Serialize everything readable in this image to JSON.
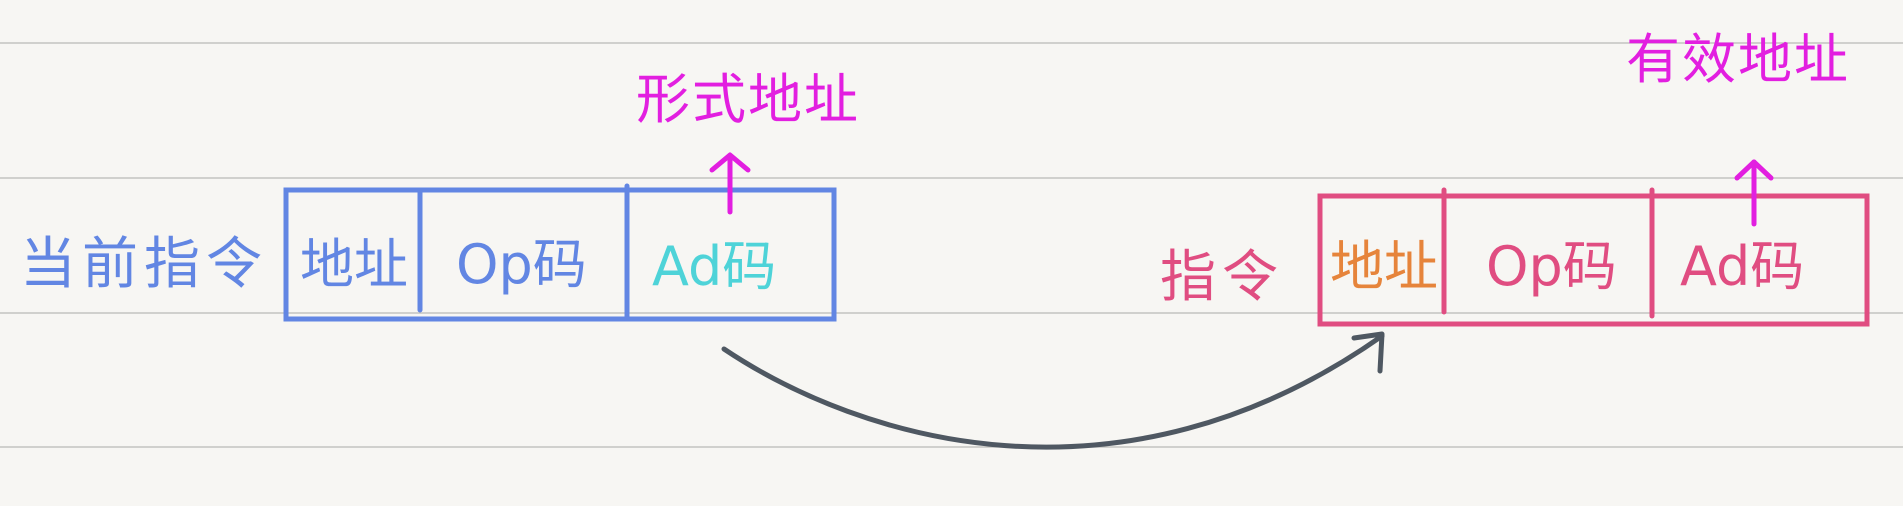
{
  "colors": {
    "background": "#f7f6f3",
    "ruled_line": "#b9b9b6",
    "current_instruction": "#6286e3",
    "address_in_current": "#6286e3",
    "op_code": "#6286e3",
    "ad_code_current": "#4ed3d8",
    "instruction": "#e04d81",
    "address_in_instruction": "#e6843b",
    "formal_address": "#e21fe0",
    "effective_address": "#e21fe0",
    "transition_arrow": "#4f5862"
  },
  "left_group": {
    "label": "当前指令",
    "cells": {
      "address": "地址",
      "opcode": "Op码",
      "adcode": "Ad码"
    },
    "annotation": "形式地址"
  },
  "right_group": {
    "label": "指令",
    "cells": {
      "address": "地址",
      "opcode": "Op码",
      "adcode": "Ad码"
    },
    "annotation": "有效地址"
  },
  "icons": {
    "up_arrow_left": "arrow-up-icon",
    "up_arrow_right": "arrow-up-icon",
    "curved_arrow": "curved-arrow-icon"
  }
}
